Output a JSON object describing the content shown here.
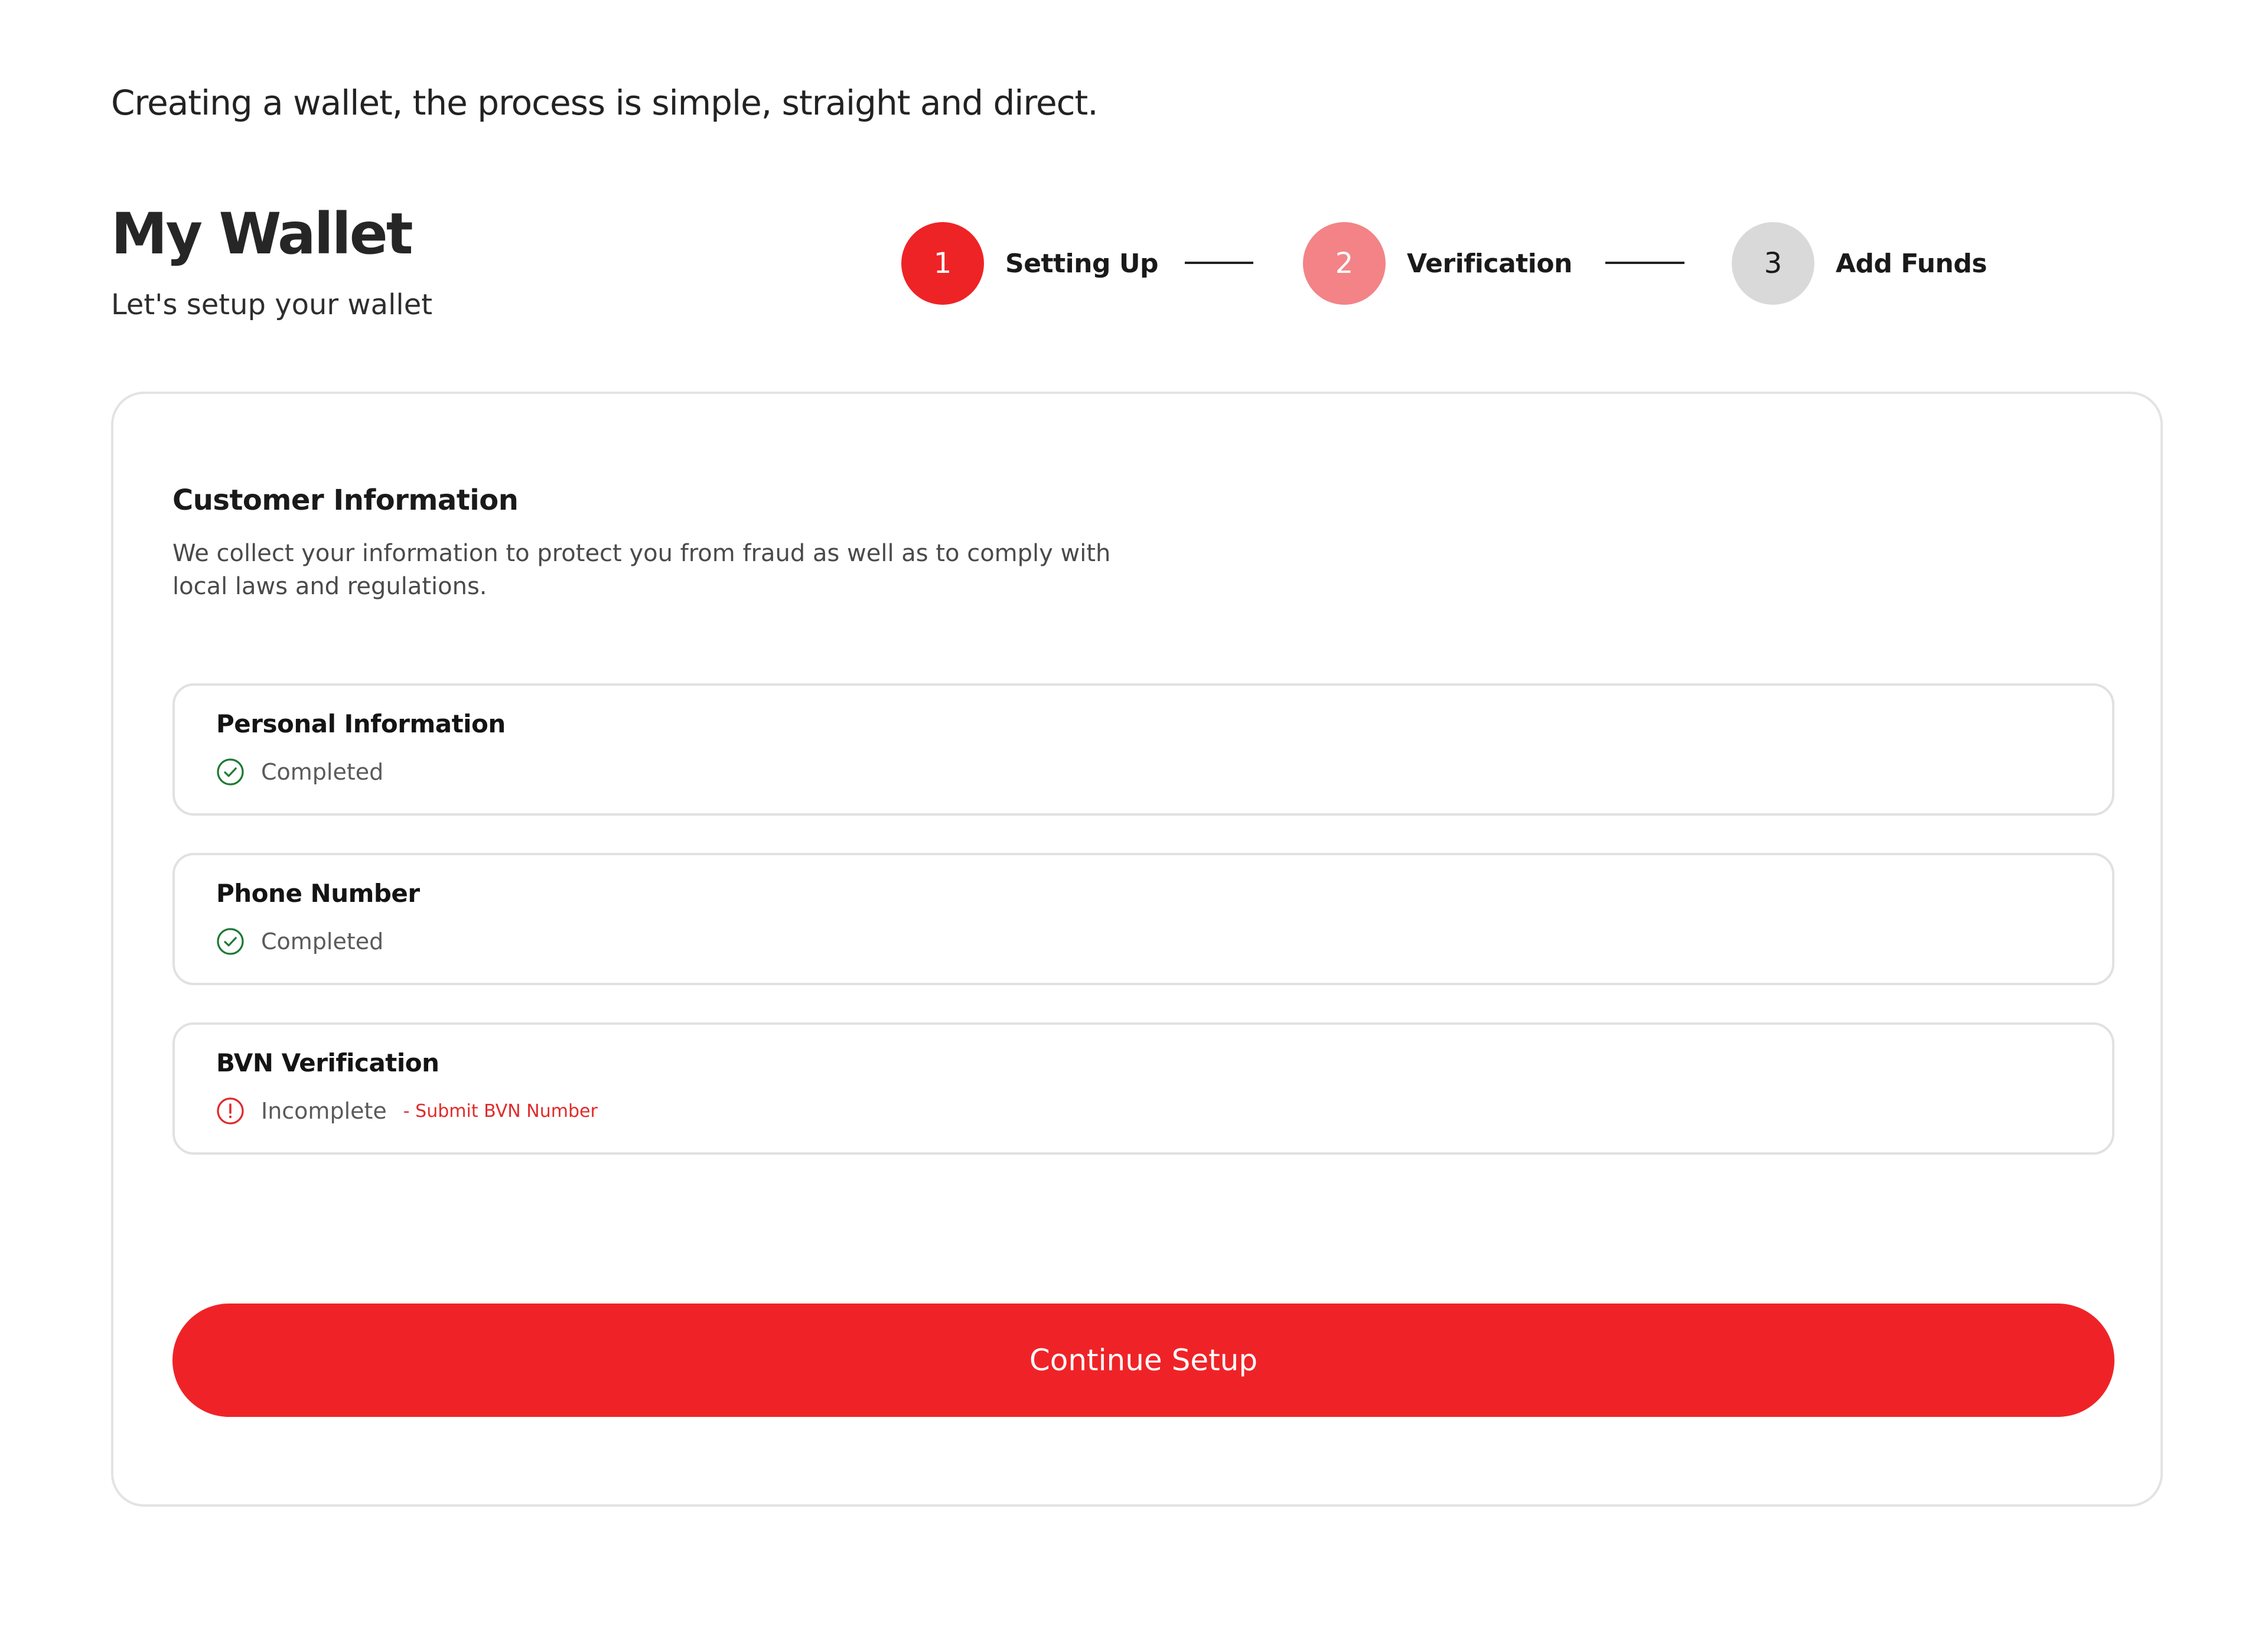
{
  "intro": "Creating a wallet, the process is simple, straight and direct.",
  "header": {
    "title": "My Wallet",
    "subtitle": "Let's setup your wallet"
  },
  "stepper": {
    "steps": [
      {
        "number": "1",
        "label": "Setting Up",
        "state": "active"
      },
      {
        "number": "2",
        "label": "Verification",
        "state": "next"
      },
      {
        "number": "3",
        "label": "Add Funds",
        "state": "pending"
      }
    ]
  },
  "card": {
    "title": "Customer Information",
    "description": "We collect your information to protect you from fraud as well as to comply with local laws and regulations.",
    "items": [
      {
        "title": "Personal Information",
        "status": "Completed",
        "icon": "check-circle-icon"
      },
      {
        "title": "Phone Number",
        "status": "Completed",
        "icon": "check-circle-icon"
      },
      {
        "title": "BVN Verification",
        "status": "Incomplete",
        "icon": "alert-circle-icon",
        "action": "- Submit BVN Number"
      }
    ],
    "continue_label": "Continue Setup"
  },
  "colors": {
    "primary": "#ef2327",
    "step_next": "#f38386",
    "step_pending": "#d9d9d9",
    "success": "#1e7a34",
    "error": "#e22a2a"
  }
}
